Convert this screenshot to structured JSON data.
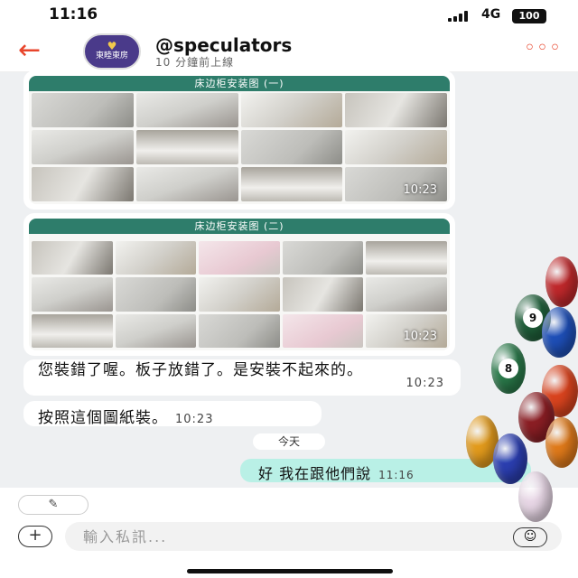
{
  "status_bar": {
    "time": "11:16",
    "network": "4G",
    "battery": "100"
  },
  "header": {
    "avatar_text": "東睦東房",
    "name": "@speculators",
    "last_online": "10 分鐘前上線"
  },
  "messages": {
    "image1": {
      "banner": "床边柜安装图 (一)",
      "time": "10:23"
    },
    "image2": {
      "banner": "床边柜安装图 (二)",
      "time": "10:23"
    },
    "msg1": {
      "text": "您裝錯了喔。板子放錯了。是安裝不起來的。",
      "time": "10:23"
    },
    "msg2": {
      "text": "按照這個圖紙裝。",
      "time": "10:23"
    },
    "date_divider": "今天",
    "msg3": {
      "text": "好 我在跟他們說",
      "time": "11:16"
    }
  },
  "composer": {
    "placeholder": "輸入私訊..."
  },
  "decor": {
    "balls": [
      {
        "number": "",
        "color": "#c0282b"
      },
      {
        "number": "9",
        "color": "#1f5f3a"
      },
      {
        "number": "",
        "color": "#1e4fb8"
      },
      {
        "number": "8",
        "color": "#2a7a4a"
      },
      {
        "number": "",
        "color": "#d9431e"
      },
      {
        "number": "",
        "color": "#8b1e24"
      },
      {
        "number": "",
        "color": "#e39b1c"
      },
      {
        "number": "",
        "color": "#2b3eb0"
      },
      {
        "number": "",
        "color": "#e07a1a"
      },
      {
        "number": "",
        "color": "#e8d7e6"
      }
    ]
  }
}
